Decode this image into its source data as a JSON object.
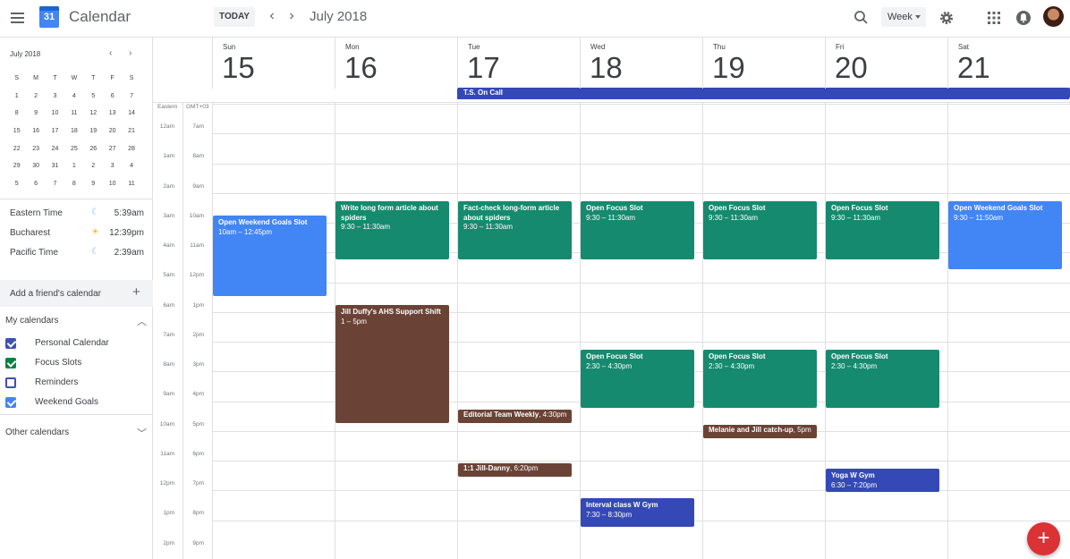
{
  "header": {
    "app_title": "Calendar",
    "logo_day": "31",
    "today_label": "TODAY",
    "range_title": "July 2018",
    "view_label": "Week",
    "prev_icon": "chevron-left-icon",
    "next_icon": "chevron-right-icon"
  },
  "mini_calendar": {
    "title": "July 2018",
    "weekday_headers": [
      "S",
      "M",
      "T",
      "W",
      "T",
      "F",
      "S"
    ],
    "days": [
      "1",
      "2",
      "3",
      "4",
      "5",
      "6",
      "7",
      "8",
      "9",
      "10",
      "11",
      "12",
      "13",
      "14",
      "15",
      "16",
      "17",
      "18",
      "19",
      "20",
      "21",
      "22",
      "23",
      "24",
      "25",
      "26",
      "27",
      "28",
      "29",
      "30",
      "31",
      "1",
      "2",
      "3",
      "4",
      "5",
      "6",
      "7",
      "8",
      "9",
      "10",
      "11"
    ],
    "selected_day": "19"
  },
  "world_clock": [
    {
      "zone": "Eastern Time",
      "time": "5:39am",
      "icon": "moon-icon"
    },
    {
      "zone": "Bucharest",
      "time": "12:39pm",
      "icon": "sun-icon"
    },
    {
      "zone": "Pacific Time",
      "time": "2:39am",
      "icon": "moon-icon"
    }
  ],
  "sidebar": {
    "add_friend_label": "Add a friend's calendar",
    "my_calendars_label": "My calendars",
    "other_calendars_label": "Other calendars",
    "calendars": [
      {
        "label": "Personal Calendar",
        "color": "#3f51b5",
        "checked": true
      },
      {
        "label": "Focus Slots",
        "color": "#0b8043",
        "checked": true
      },
      {
        "label": "Reminders",
        "color": "#3f51b5",
        "checked": false
      },
      {
        "label": "Weekend Goals",
        "color": "#4285f4",
        "checked": true
      }
    ]
  },
  "week": {
    "days": [
      {
        "name": "Sun",
        "num": "15"
      },
      {
        "name": "Mon",
        "num": "16"
      },
      {
        "name": "Tue",
        "num": "17"
      },
      {
        "name": "Wed",
        "num": "18"
      },
      {
        "name": "Thu",
        "num": "19"
      },
      {
        "name": "Fri",
        "num": "20"
      },
      {
        "name": "Sat",
        "num": "21"
      }
    ],
    "all_day_event": {
      "title": "T.S. On Call",
      "color": "#3449b6"
    },
    "tz_labels": {
      "primary": "Eastern",
      "secondary": "GMT+03"
    },
    "hours_primary": [
      "12am",
      "1am",
      "2am",
      "3am",
      "4am",
      "5am",
      "6am",
      "7am",
      "8am",
      "9am",
      "10am",
      "11am",
      "12pm",
      "1pm",
      "2pm"
    ],
    "hours_secondary": [
      "7am",
      "8am",
      "9am",
      "10am",
      "11am",
      "12pm",
      "1pm",
      "2pm",
      "3pm",
      "4pm",
      "5pm",
      "6pm",
      "7pm",
      "8pm",
      "9pm"
    ]
  },
  "events": [
    {
      "title": "Open Weekend Goals Slot",
      "time": "10am – 12:45pm",
      "color": "#4285f4"
    },
    {
      "title": "Write long form article about spiders",
      "time": "9:30 – 11:30am",
      "color": "#168a6f"
    },
    {
      "title": "Jill Duffy's AHS Support Shift",
      "time": "1 – 5pm",
      "color": "#6b4336"
    },
    {
      "title": "Fact-check long-form article about spiders",
      "time": "9:30 – 11:30am",
      "color": "#168a6f"
    },
    {
      "title": "Editorial Team Weekly",
      "time": ", 4:30pm",
      "color": "#6b4336"
    },
    {
      "title": "1:1 Jill-Danny",
      "time": ", 6:20pm",
      "color": "#6b4336"
    },
    {
      "title": "Open Focus Slot",
      "time": "9:30 – 11:30am",
      "color": "#168a6f"
    },
    {
      "title": "Open Focus Slot",
      "time": "2:30 – 4:30pm",
      "color": "#168a6f"
    },
    {
      "title": "Interval class W Gym",
      "time": "7:30 – 8:30pm",
      "color": "#3449b6"
    },
    {
      "title": "Open Focus Slot",
      "time": "9:30 – 11:30am",
      "color": "#168a6f"
    },
    {
      "title": "Open Focus Slot",
      "time": "2:30 – 4:30pm",
      "color": "#168a6f"
    },
    {
      "title": "Melanie and Jill catch-up",
      "time": ", 5pm",
      "color": "#6b4336"
    },
    {
      "title": "Open Focus Slot",
      "time": "9:30 – 11:30am",
      "color": "#168a6f"
    },
    {
      "title": "Open Focus Slot",
      "time": "2:30 – 4:30pm",
      "color": "#168a6f"
    },
    {
      "title": "Yoga W Gym",
      "time": "6:30 – 7:20pm",
      "color": "#3449b6"
    },
    {
      "title": "Open Weekend Goals Slot",
      "time": "9:30 – 11:50am",
      "color": "#4285f4"
    }
  ]
}
